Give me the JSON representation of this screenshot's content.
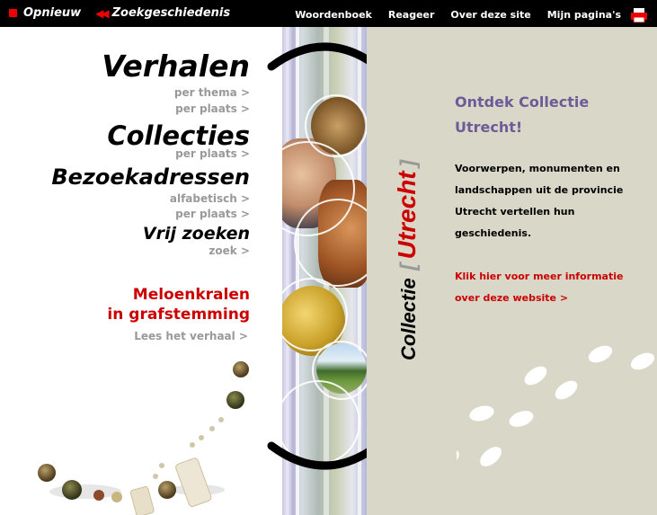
{
  "topbar": {
    "restart": "Opnieuw",
    "history": "Zoekgeschiedenis",
    "links": [
      "Woordenboek",
      "Reageer",
      "Over deze site",
      "Mijn pagina's"
    ]
  },
  "nav": {
    "verhalen": "Verhalen",
    "verhalen_thema": "per thema >",
    "verhalen_plaats": "per plaats >",
    "collecties": "Collecties",
    "collecties_plaats": "per plaats >",
    "bezoekadressen": "Bezoekadressen",
    "bezoek_alfabetisch": "alfabetisch >",
    "bezoek_plaats": "per plaats >",
    "vrij_zoeken": "Vrij zoeken",
    "zoek": "zoek >"
  },
  "feature": {
    "line1": "Meloenkralen",
    "line2": "in grafstemming",
    "read_more": "Lees het verhaal >"
  },
  "logo": {
    "collectie": "Collectie",
    "bracket_open": "[",
    "utrecht": "Utrecht",
    "bracket_close": "]"
  },
  "main": {
    "headline_line1": "Ontdek Collectie",
    "headline_line2": "Utrecht!",
    "intro_lines": [
      "Voorwerpen, monumenten en",
      "landschappen uit de provincie",
      "Utrecht vertellen hun",
      "geschiedenis."
    ],
    "info_lines": [
      "Klik hier voor meer informatie",
      "over deze website >"
    ]
  },
  "colors": {
    "accent_red": "#cc0000",
    "headline_purple": "#6d5b98",
    "panel_beige": "#d8d7c8",
    "subtle_grey": "#999999"
  },
  "icons": [
    "printer-icon",
    "double-arrow-left-icon"
  ]
}
